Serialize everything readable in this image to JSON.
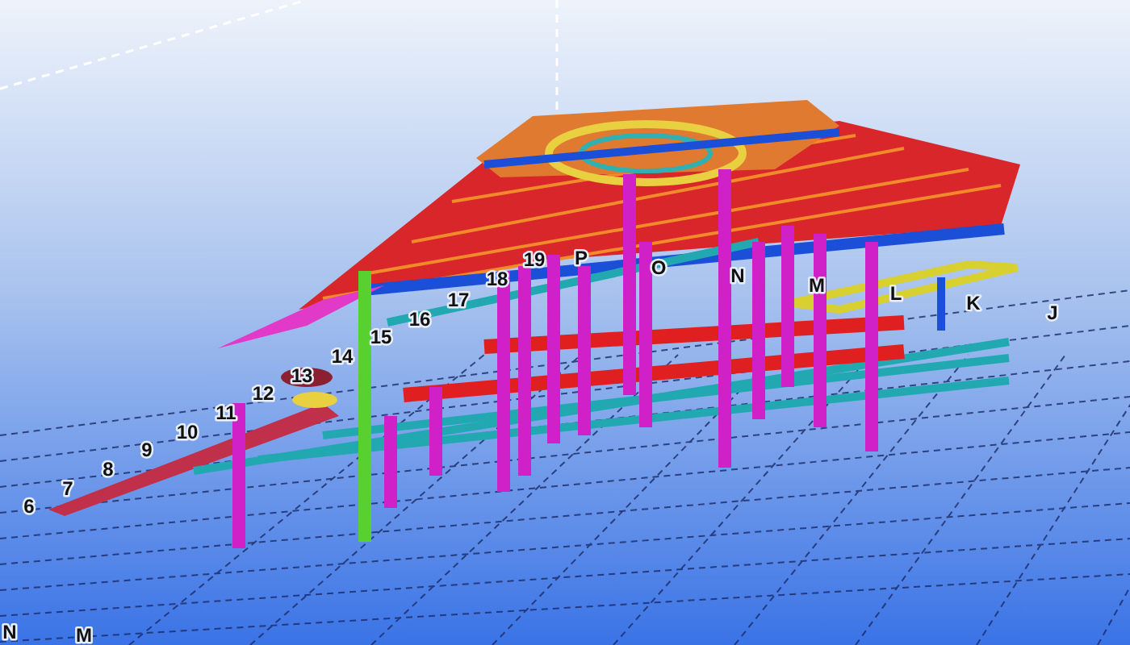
{
  "model_view": {
    "grid_labels": [
      "6",
      "7",
      "8",
      "9",
      "10",
      "11",
      "12",
      "13",
      "14",
      "15",
      "16",
      "17",
      "18",
      "19",
      "P",
      "O",
      "N",
      "M",
      "L",
      "K",
      "J"
    ],
    "foreground_grid_labels": [
      "N",
      "M"
    ]
  }
}
